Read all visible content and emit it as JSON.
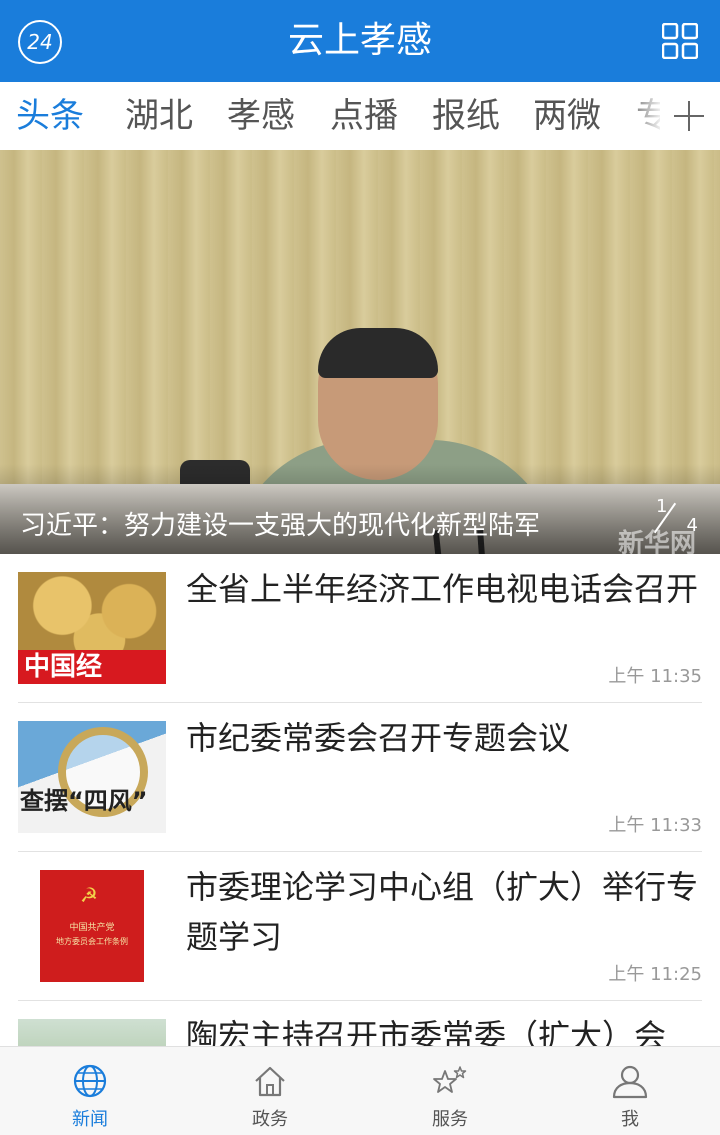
{
  "header": {
    "title": "云上孝感",
    "logo_text": "24",
    "logo_icon": "logo-24-icon",
    "menu_icon": "grid-icon",
    "background_color": "#1a7ddb"
  },
  "tabs": {
    "items": [
      {
        "label": "头条",
        "active": true
      },
      {
        "label": "湖北",
        "active": false
      },
      {
        "label": "孝感",
        "active": false
      },
      {
        "label": "点播",
        "active": false
      },
      {
        "label": "报纸",
        "active": false
      },
      {
        "label": "两微",
        "active": false
      },
      {
        "label": "专",
        "active": false
      }
    ],
    "add_icon": "plus-icon",
    "active_color": "#1a7ddb"
  },
  "hero": {
    "caption": "习近平：努力建设一支强大的现代化新型陆军",
    "pager_current": "1",
    "pager_total": "4",
    "watermark": "新华网"
  },
  "news": [
    {
      "title": "全省上半年经济工作电视电话会召开",
      "time": "上午 11:35",
      "thumb_text": "中国经"
    },
    {
      "title": "市纪委常委会召开专题会议",
      "time": "上午 11:33",
      "thumb_text": "查摆“四风”"
    },
    {
      "title": "市委理论学习中心组（扩大）举行专题学习",
      "time": "上午 11:25",
      "thumb_line1": "中国共产党",
      "thumb_line2": "地方委员会工作条例"
    },
    {
      "title": "陶宏主持召开市委常委（扩大）会",
      "time": ""
    }
  ],
  "bottom_nav": {
    "items": [
      {
        "label": "新闻",
        "icon": "globe-icon",
        "active": true
      },
      {
        "label": "政务",
        "icon": "home-icon",
        "active": false
      },
      {
        "label": "服务",
        "icon": "stars-icon",
        "active": false
      },
      {
        "label": "我",
        "icon": "user-icon",
        "active": false
      }
    ]
  }
}
